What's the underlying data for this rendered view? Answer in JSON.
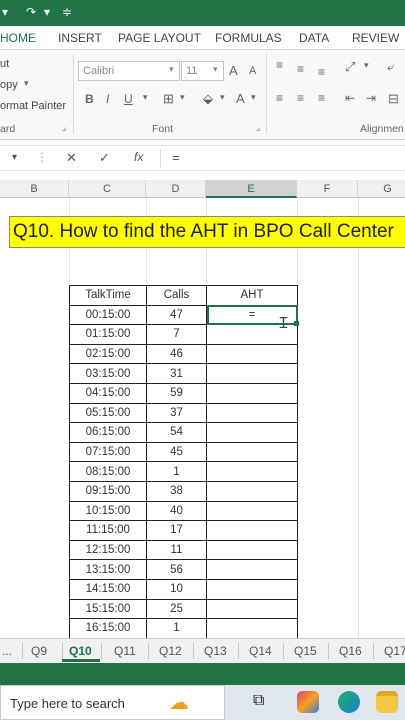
{
  "qat": {
    "icons": [
      "undo-icon",
      "redo-icon",
      "customize-icon"
    ]
  },
  "ribbon_tabs": [
    {
      "label": "HOME",
      "active": true
    },
    {
      "label": "INSERT",
      "active": false
    },
    {
      "label": "PAGE LAYOUT",
      "active": false
    },
    {
      "label": "FORMULAS",
      "active": false
    },
    {
      "label": "DATA",
      "active": false
    },
    {
      "label": "REVIEW",
      "active": false
    }
  ],
  "clipboard": {
    "cut": "ut",
    "copy": "opy",
    "format_painter": "ormat Painter",
    "group": "ard"
  },
  "font": {
    "name": "Calibri",
    "size": "11",
    "bold": "B",
    "italic": "I",
    "underline": "U",
    "group": "Font",
    "grow": "A",
    "shrink": "A",
    "color": "A"
  },
  "alignment": {
    "group": "Alignmen"
  },
  "formula_bar": {
    "fx": "fx",
    "value": "="
  },
  "columns": [
    "B",
    "C",
    "D",
    "E",
    "F",
    "G"
  ],
  "selected_column": "E",
  "banner": "Q10. How to find the AHT in BPO Call Center",
  "table": {
    "headers": [
      "TalkTime",
      "Calls",
      "AHT"
    ],
    "rows": [
      [
        "00:15:00",
        "47",
        "="
      ],
      [
        "01:15:00",
        "7",
        ""
      ],
      [
        "02:15:00",
        "46",
        ""
      ],
      [
        "03:15:00",
        "31",
        ""
      ],
      [
        "04:15:00",
        "59",
        ""
      ],
      [
        "05:15:00",
        "37",
        ""
      ],
      [
        "06:15:00",
        "54",
        ""
      ],
      [
        "07:15:00",
        "45",
        ""
      ],
      [
        "08:15:00",
        "1",
        ""
      ],
      [
        "09:15:00",
        "38",
        ""
      ],
      [
        "10:15:00",
        "40",
        ""
      ],
      [
        "11:15:00",
        "17",
        ""
      ],
      [
        "12:15:00",
        "11",
        ""
      ],
      [
        "13:15:00",
        "56",
        ""
      ],
      [
        "14:15:00",
        "10",
        ""
      ],
      [
        "15:15:00",
        "25",
        ""
      ],
      [
        "16:15:00",
        "1",
        ""
      ]
    ]
  },
  "sheet_tabs": [
    "...",
    "Q9",
    "Q10",
    "Q11",
    "Q12",
    "Q13",
    "Q14",
    "Q15",
    "Q16",
    "Q17"
  ],
  "active_sheet": "Q10",
  "taskbar": {
    "search_placeholder": "Type here to search"
  },
  "colors": {
    "excel_green": "#217346",
    "banner_yellow": "#ffff00"
  }
}
